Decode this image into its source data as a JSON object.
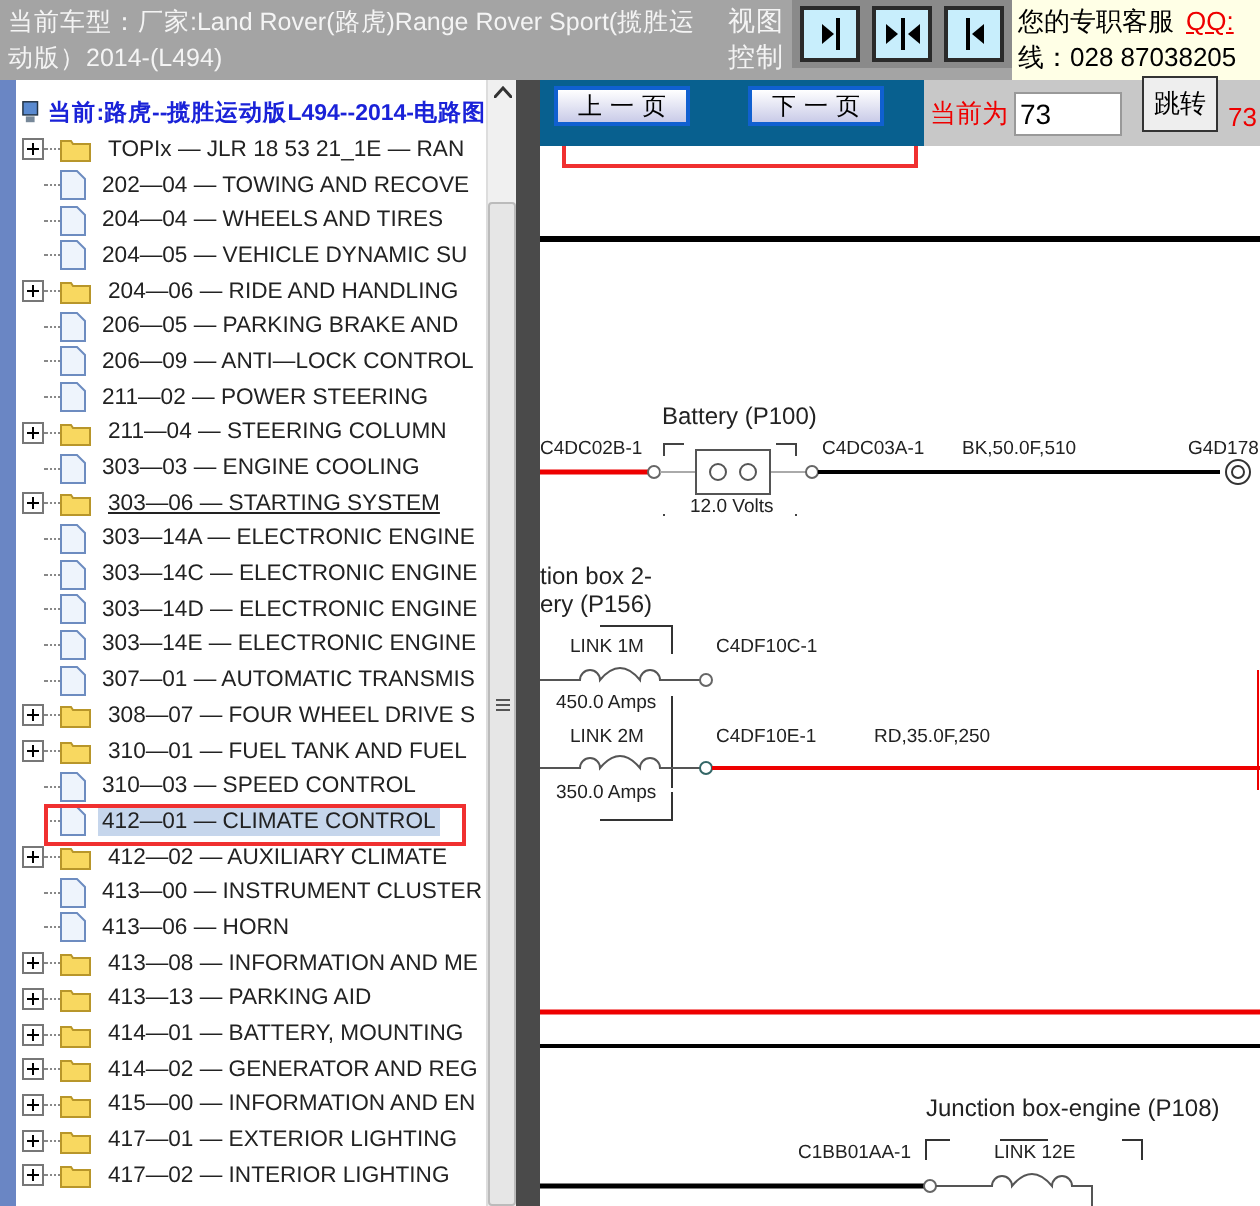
{
  "header": {
    "vehicle": "当前车型：厂家:Land Rover(路虎)Range Rover Sport(揽胜运动版）2014-(L494)",
    "view_label": "视图控制",
    "view_buttons": [
      {
        "kind": "right"
      },
      {
        "kind": "split"
      },
      {
        "kind": "left"
      }
    ],
    "service_label": "您的专职客服",
    "service_qq": "QQ:",
    "service_phone": "线：028 87038205"
  },
  "tree": {
    "title": "当前:路虎--揽胜运动版L494--2014-电路图",
    "items": [
      {
        "kind": "folder",
        "label": "TOPIx — JLR 18 53 21_1E — RAN",
        "selected": false,
        "underlined": false
      },
      {
        "kind": "file",
        "label": "202—04 — TOWING AND RECOVE",
        "selected": false,
        "underlined": false
      },
      {
        "kind": "file",
        "label": "204—04 — WHEELS AND TIRES",
        "selected": false,
        "underlined": false
      },
      {
        "kind": "file",
        "label": "204—05 — VEHICLE DYNAMIC SU",
        "selected": false,
        "underlined": false
      },
      {
        "kind": "folder",
        "label": "204—06 — RIDE AND HANDLING",
        "selected": false,
        "underlined": false
      },
      {
        "kind": "file",
        "label": "206—05 — PARKING BRAKE AND",
        "selected": false,
        "underlined": false
      },
      {
        "kind": "file",
        "label": "206—09 — ANTI—LOCK CONTROL",
        "selected": false,
        "underlined": false
      },
      {
        "kind": "file",
        "label": "211—02 — POWER STEERING",
        "selected": false,
        "underlined": false
      },
      {
        "kind": "folder",
        "label": "211—04 — STEERING COLUMN",
        "selected": false,
        "underlined": false
      },
      {
        "kind": "file",
        "label": "303—03 — ENGINE COOLING",
        "selected": false,
        "underlined": false
      },
      {
        "kind": "folder",
        "label": "303—06 — STARTING SYSTEM",
        "selected": false,
        "underlined": true
      },
      {
        "kind": "file",
        "label": "303—14A — ELECTRONIC ENGINE",
        "selected": false,
        "underlined": false
      },
      {
        "kind": "file",
        "label": "303—14C — ELECTRONIC ENGINE",
        "selected": false,
        "underlined": false
      },
      {
        "kind": "file",
        "label": "303—14D — ELECTRONIC ENGINE",
        "selected": false,
        "underlined": false
      },
      {
        "kind": "file",
        "label": "303—14E — ELECTRONIC ENGINE",
        "selected": false,
        "underlined": false
      },
      {
        "kind": "file",
        "label": "307—01 — AUTOMATIC TRANSMIS",
        "selected": false,
        "underlined": false
      },
      {
        "kind": "folder",
        "label": "308—07 — FOUR WHEEL DRIVE S",
        "selected": false,
        "underlined": false
      },
      {
        "kind": "folder",
        "label": "310—01 — FUEL TANK AND FUEL",
        "selected": false,
        "underlined": false
      },
      {
        "kind": "file",
        "label": "310—03 — SPEED CONTROL",
        "selected": false,
        "underlined": false
      },
      {
        "kind": "file",
        "label": "412—01 — CLIMATE CONTROL",
        "selected": true,
        "underlined": false
      },
      {
        "kind": "folder",
        "label": "412—02 — AUXILIARY CLIMATE",
        "selected": false,
        "underlined": false
      },
      {
        "kind": "file",
        "label": "413—00 — INSTRUMENT CLUSTER",
        "selected": false,
        "underlined": false
      },
      {
        "kind": "file",
        "label": "413—06 — HORN",
        "selected": false,
        "underlined": false
      },
      {
        "kind": "folder",
        "label": "413—08 — INFORMATION AND ME",
        "selected": false,
        "underlined": false
      },
      {
        "kind": "folder",
        "label": "413—13 — PARKING AID",
        "selected": false,
        "underlined": false
      },
      {
        "kind": "folder",
        "label": "414—01 — BATTERY, MOUNTING",
        "selected": false,
        "underlined": false
      },
      {
        "kind": "folder",
        "label": "414—02 — GENERATOR AND REG",
        "selected": false,
        "underlined": false
      },
      {
        "kind": "folder",
        "label": "415—00 — INFORMATION AND EN",
        "selected": false,
        "underlined": false
      },
      {
        "kind": "folder",
        "label": "417—01 — EXTERIOR LIGHTING",
        "selected": false,
        "underlined": false
      },
      {
        "kind": "folder",
        "label": "417—02 — INTERIOR LIGHTING",
        "selected": false,
        "underlined": false
      }
    ]
  },
  "pager": {
    "prev": "上 一 页",
    "next": "下 一 页",
    "current_label": "当前为",
    "page_value": "73",
    "go": "跳转",
    "total": "73"
  },
  "diagram": {
    "labels": [
      {
        "text": "Battery (P100)",
        "kind": "title"
      },
      {
        "text": "C4DC02B-1",
        "kind": "pin"
      },
      {
        "text": "12.0 Volts",
        "kind": "rating"
      },
      {
        "text": "C4DC03A-1",
        "kind": "pin"
      },
      {
        "text": "BK,50.0F,510",
        "kind": "wire"
      },
      {
        "text": "G4D178",
        "kind": "pin"
      },
      {
        "text": "tion box 2-",
        "kind": "title"
      },
      {
        "text": "ery (P156)",
        "kind": "title"
      },
      {
        "text": "LINK 1M",
        "kind": "pin"
      },
      {
        "text": "C4DF10C-1",
        "kind": "pin"
      },
      {
        "text": "450.0 Amps",
        "kind": "rating"
      },
      {
        "text": "LINK 2M",
        "kind": "pin"
      },
      {
        "text": "C4DF10E-1",
        "kind": "pin"
      },
      {
        "text": "RD,35.0F,250",
        "kind": "wire"
      },
      {
        "text": "350.0 Amps",
        "kind": "rating"
      },
      {
        "text": "Junction box-engine (P108)",
        "kind": "title"
      },
      {
        "text": "C1BB01AA-1",
        "kind": "pin"
      },
      {
        "text": "LINK 12E",
        "kind": "pin"
      }
    ]
  }
}
